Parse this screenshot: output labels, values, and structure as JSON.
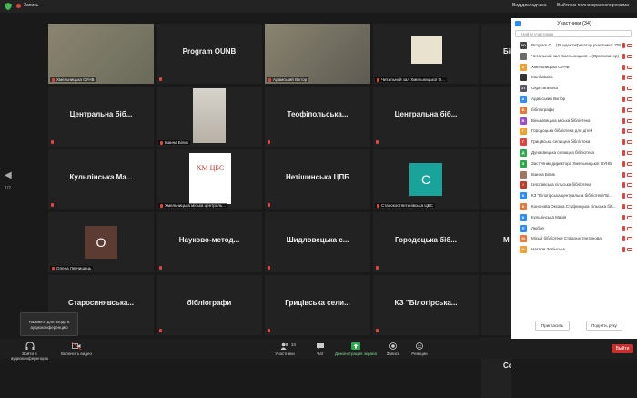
{
  "topbar": {
    "record_label": "Запись",
    "view_label": "Вид докладчика",
    "fullscreen_label": "Выйти из полноэкранного режима"
  },
  "tiles": [
    {
      "name": "",
      "label": "Хмельницька ОУНБ",
      "color": "#6a6a5a"
    },
    {
      "name": "Program OUNB",
      "label": ""
    },
    {
      "name": "",
      "label": "Адамський Віктор",
      "color": "#5d5a52"
    },
    {
      "name": "",
      "label": "Читальний зал Хмельницької О...",
      "color": "#fff"
    },
    {
      "name": "Центральна біб...",
      "label": ""
    },
    {
      "name": "",
      "label": "Іванна Білик",
      "color": "#2a2a2a"
    },
    {
      "name": "Теофіпольська...",
      "label": ""
    },
    {
      "name": "Центральна біб...",
      "label": ""
    },
    {
      "name": "Кульпінська Ма...",
      "label": ""
    },
    {
      "name": "",
      "label": "Хмельницька міська централь...",
      "color": "#fff"
    },
    {
      "name": "Нетішинська ЦПБ",
      "label": ""
    },
    {
      "name": "",
      "label": "Старокостянтинівська ЦБС",
      "color": "#2a2a2a"
    },
    {
      "name": "",
      "label": "Олена Левчишець",
      "color": "#2a2a2a"
    },
    {
      "name": "Науково-метод...",
      "label": ""
    },
    {
      "name": "Шидловецька с...",
      "label": ""
    },
    {
      "name": "Городоцька біб...",
      "label": ""
    },
    {
      "name": "Старосинявська...",
      "label": ""
    },
    {
      "name": "бібліографи",
      "label": ""
    },
    {
      "name": "Грицівська сели...",
      "label": ""
    },
    {
      "name": "КЗ \"Білогірська...",
      "label": ""
    }
  ],
  "right_partial": [
    "Бі",
    "",
    "",
    "М",
    "",
    "Со"
  ],
  "tile_letters": {
    "t11": "С",
    "t12": "О"
  },
  "logo_text": "ХМ ЦБС",
  "page": {
    "arrow": "◀",
    "number": "1/2"
  },
  "audio_tip": {
    "line1": "Нажмите для входа в",
    "line2": "аудиоконференцию"
  },
  "bottom": {
    "join_audio": "Войти в аудиоконференцию",
    "start_video": "Включить видео",
    "participants": "Участники",
    "participants_count": "34",
    "chat": "Чат",
    "share": "Демонстрация экрана",
    "record": "Запись",
    "reactions": "Реакции",
    "end": "Выйти"
  },
  "panel": {
    "title": "Участники (34)",
    "search_placeholder": "Найти участника",
    "invite": "Пригласить",
    "raise_hand": "Поднять руку",
    "participants": [
      {
        "initials": "PO",
        "name": "Program O... (Я, идентификатор участника: 709063)",
        "color": "#444"
      },
      {
        "initials": "",
        "name": "Читальний зал Хмельницької... (Организатор)",
        "color": "#6b6b6b"
      },
      {
        "initials": "Х",
        "name": "Хмельницька ОУНБ",
        "color": "#f0a030"
      },
      {
        "initials": "",
        "name": "Marikababa",
        "color": "#333"
      },
      {
        "initials": "OT",
        "name": "Olga Tarasova",
        "color": "#556"
      },
      {
        "initials": "А",
        "name": "Адамський Віктор",
        "color": "#2d8cff"
      },
      {
        "initials": "Б",
        "name": "бібліографи",
        "color": "#e8793a"
      },
      {
        "initials": "В",
        "name": "Віньковецька міська бібліотека",
        "color": "#9a4ad8"
      },
      {
        "initials": "Г",
        "name": "Городоцька бібліотека для дітей",
        "color": "#f0a030"
      },
      {
        "initials": "Г",
        "name": "Грицівська селищна бібліотека",
        "color": "#e0443e"
      },
      {
        "initials": "Д",
        "name": "Дунаєвецька селищна бібліотека",
        "color": "#2aa84a"
      },
      {
        "initials": "З",
        "name": "Заступник директора Хмельницької ОУНБ",
        "color": "#2aa84a"
      },
      {
        "initials": "",
        "name": "Іванна Білик",
        "color": "#a07860"
      },
      {
        "initials": "І",
        "name": "Ізяславська сільська бібліотека",
        "color": "#c0392b"
      },
      {
        "initials": "К",
        "name": "КЗ \"Білогірська центральна бібліотека\"Бі...",
        "color": "#2d8cff"
      },
      {
        "initials": "К",
        "name": "Кононова Оксана Стуфницька сільська біб...",
        "color": "#e8793a"
      },
      {
        "initials": "К",
        "name": "Кульпінська Марія",
        "color": "#2d8cff"
      },
      {
        "initials": "Л",
        "name": "Любов",
        "color": "#2d8cff"
      },
      {
        "initials": "М",
        "name": "Міські бібліотеки Старокостянтинова",
        "color": "#e8793a"
      },
      {
        "initials": "Н",
        "name": "Наталя Зелінська",
        "color": "#f0a030"
      }
    ]
  }
}
